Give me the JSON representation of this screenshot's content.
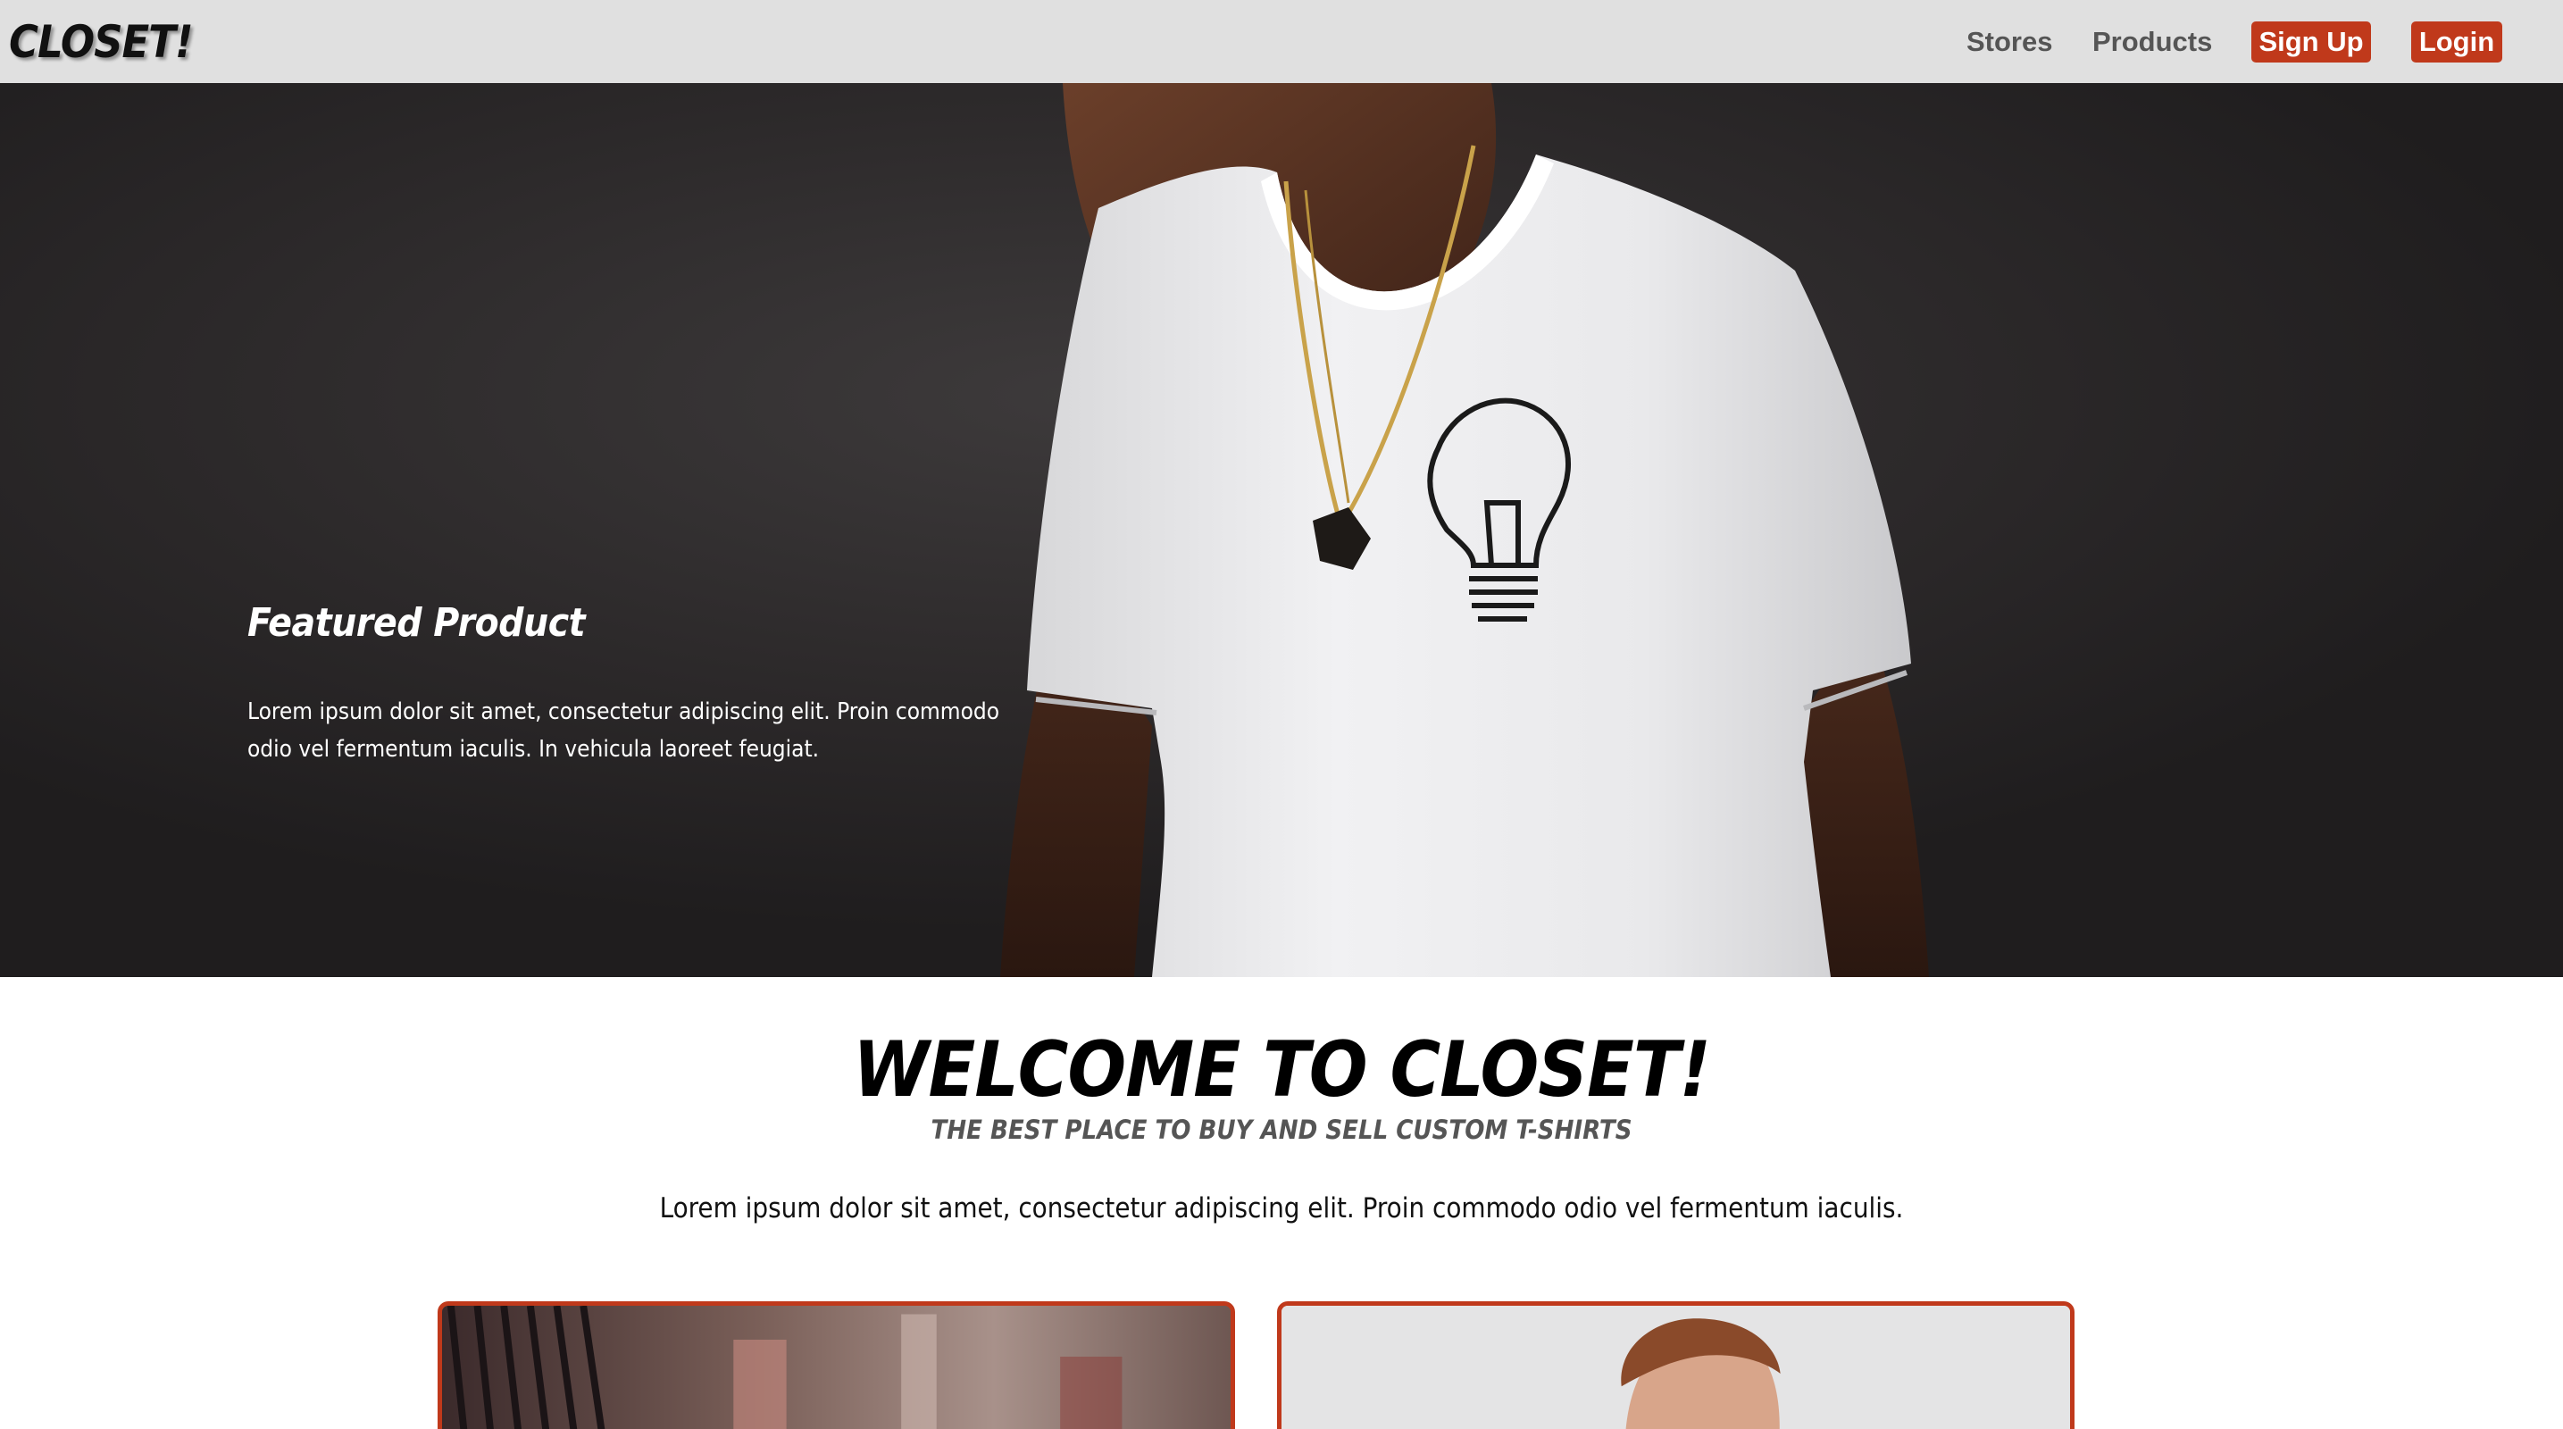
{
  "brand": "CLOSET!",
  "nav": {
    "stores": "Stores",
    "products": "Products",
    "signup": "Sign Up",
    "login": "Login"
  },
  "hero": {
    "title": "Featured Product",
    "text": "Lorem ipsum dolor sit amet, consectetur adipiscing elit. Proin commodo odio vel fermentum iaculis. In vehicula laoreet feugiat."
  },
  "welcome": {
    "title": "WELCOME TO CLOSET!",
    "subtitle": "THE BEST PLACE TO BUY AND SELL CUSTOM T-SHIRTS",
    "text": "Lorem ipsum dolor sit amet, consectetur adipiscing elit. Proin commodo odio vel fermentum iaculis."
  },
  "colors": {
    "accent": "#c0391b",
    "navbar_bg": "#e0e0e0",
    "nav_link": "#555555",
    "hero_bg": "#2a2728"
  },
  "icons": {
    "hero_image": "man-in-white-tshirt-image",
    "card_left_image": "clothing-rack-image",
    "card_right_image": "male-model-image"
  }
}
